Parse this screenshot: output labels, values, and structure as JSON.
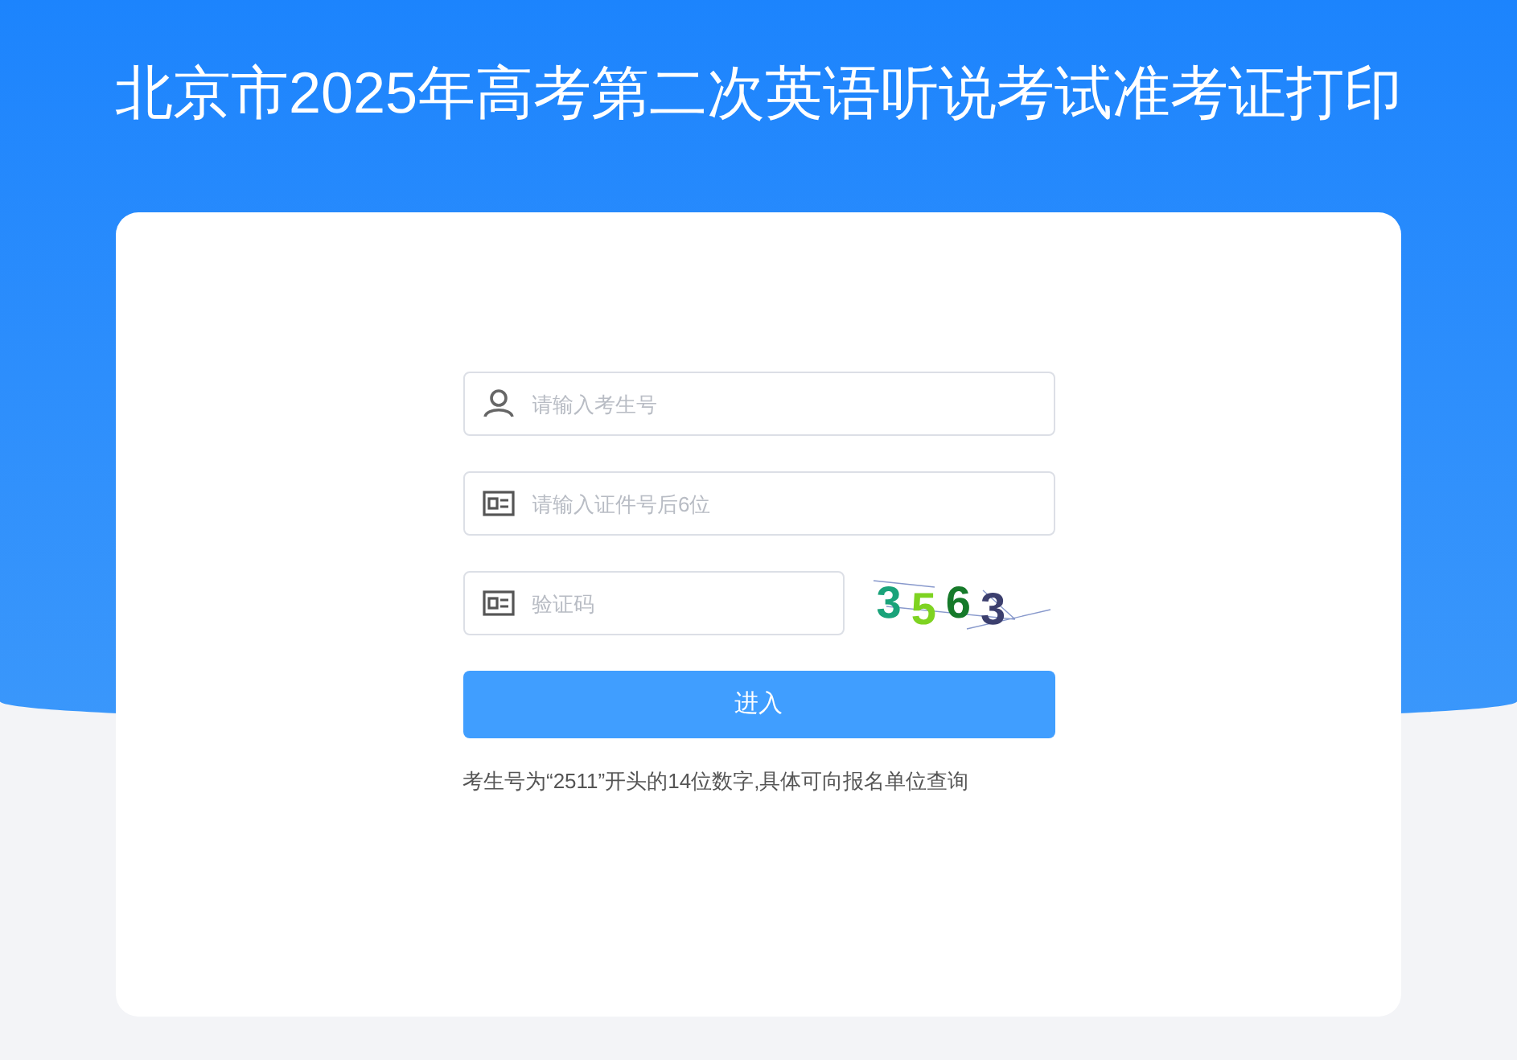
{
  "title": "北京市2025年高考第二次英语听说考试准考证打印",
  "form": {
    "fields": [
      {
        "kind": "user",
        "placeholder": "请输入考生号"
      },
      {
        "kind": "idcard",
        "placeholder": "请输入证件号后6位"
      },
      {
        "kind": "captcha",
        "placeholder": "验证码"
      }
    ],
    "captcha": [
      {
        "digit": "3",
        "color": "#1aa37a"
      },
      {
        "digit": "5",
        "color": "#7ed321"
      },
      {
        "digit": "6",
        "color": "#167a2a"
      },
      {
        "digit": "3",
        "color": "#3c3f6e"
      }
    ],
    "submit": "进入",
    "hint": "考生号为“2511”开头的14位数字,具体可向报名单位查询"
  }
}
